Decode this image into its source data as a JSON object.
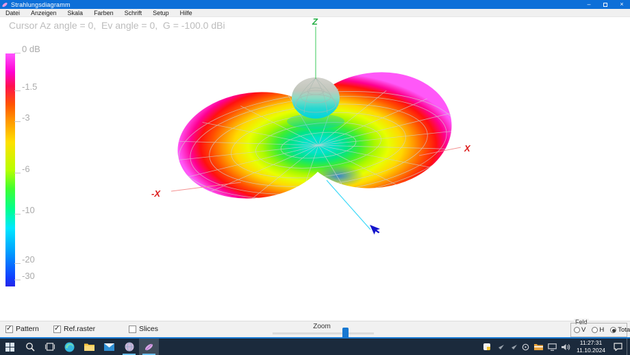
{
  "window": {
    "title": "Strahlungsdiagramm",
    "minimize_glyph": "–",
    "close_glyph": "×"
  },
  "menu": {
    "items": [
      "Datei",
      "Anzeigen",
      "Skala",
      "Farben",
      "Schrift",
      "Setup",
      "Hilfe"
    ]
  },
  "plot": {
    "cursor_readout": "Cursor Az angle = 0,  Ev angle = 0,  G = -100.0 dBi",
    "axis_labels": {
      "z": "Z",
      "x": "X",
      "neg_x": "-X"
    },
    "scale_ticks": [
      "0 dB",
      "-1.5",
      "-3",
      "-6",
      "-10",
      "-20",
      "-30"
    ]
  },
  "chart_data": {
    "type": "3d-surface-radiation-pattern",
    "gain_scale_dB": [
      0,
      -1.5,
      -3,
      -6,
      -10,
      -20,
      -30
    ],
    "colormap_top_to_bottom": [
      "magenta",
      "red",
      "orange",
      "yellow",
      "green",
      "cyan",
      "blue"
    ],
    "cursor": {
      "az_angle": 0,
      "ev_angle": 0,
      "gain_dBi": -100.0
    }
  },
  "controls": {
    "checkboxes": [
      {
        "label": "Pattern",
        "checked": true
      },
      {
        "label": "Ref.raster",
        "checked": true
      },
      {
        "label": "Slices",
        "checked": false
      }
    ],
    "zoom_label": "Zoom",
    "feld": {
      "label": "Feld",
      "options": [
        {
          "label": "V",
          "selected": false
        },
        {
          "label": "H",
          "selected": false
        },
        {
          "label": "Total",
          "selected": true
        }
      ]
    }
  },
  "taskbar": {
    "app_icons": [
      "start",
      "search",
      "task-view",
      "edge",
      "file-explorer",
      "mail",
      "globe",
      "radiation-app"
    ],
    "tray_icons": [
      "color-app",
      "plane-1",
      "plane-2",
      "sync",
      "folder",
      "display",
      "volume"
    ],
    "clock": {
      "time": "11:27:31",
      "date": "11.10.2024"
    }
  },
  "colors": {
    "accent": "#0d6fd8",
    "taskbar": "#1b2a3c"
  }
}
